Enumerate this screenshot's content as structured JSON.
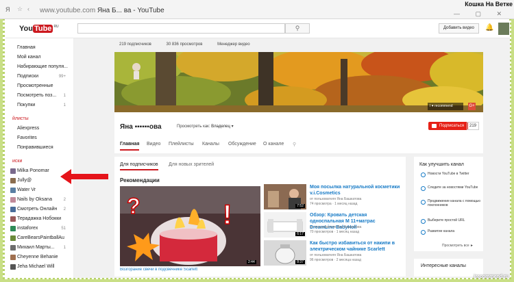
{
  "browser": {
    "tab_icon": "Я",
    "url_host": "www.youtube.com",
    "url_title": "Яна Б... ва - YouTube",
    "watermark": "Кошка На Ветке"
  },
  "header": {
    "logo_you": "You",
    "logo_tube": "Tube",
    "logo_region": "RU",
    "upload_label": "Добавить видео"
  },
  "sidebar": {
    "items": [
      {
        "label": "Главная",
        "count": "",
        "color": ""
      },
      {
        "label": "Мой канал",
        "count": "",
        "color": ""
      },
      {
        "label": "Набирающие популя...",
        "count": "",
        "color": ""
      },
      {
        "label": "Подписки",
        "count": "99+",
        "color": ""
      },
      {
        "label": "Просмотренные",
        "count": "",
        "color": ""
      },
      {
        "label": "Посмотреть поз...",
        "count": "1",
        "color": ""
      },
      {
        "label": "Покупки",
        "count": "1",
        "color": ""
      }
    ],
    "section_playlists": "йлисты",
    "playlists": [
      {
        "label": "Aliexpress"
      },
      {
        "label": "Favorites"
      },
      {
        "label": "Понравившиеся"
      }
    ],
    "section_subscriptions": "иски",
    "subscriptions": [
      {
        "label": "Milka Ponomar",
        "count": "",
        "color": "#7a6a8c"
      },
      {
        "label": "Jully@",
        "count": "",
        "color": "#8a6d4f"
      },
      {
        "label": "Water Vr",
        "count": "",
        "color": "#5a7fa3"
      },
      {
        "label": "Nails by Oksana",
        "count": "2",
        "color": "#c08a9a"
      },
      {
        "label": "Смотреть Онлайн",
        "count": "2",
        "color": "#4a6d9a"
      },
      {
        "label": "Терадажка Нобокки",
        "count": "",
        "color": "#9a5a5a"
      },
      {
        "label": "instaforex",
        "count": "51",
        "color": "#2e8b57"
      },
      {
        "label": "CareBearsPaintballAu",
        "count": "",
        "color": "#6a8a3a"
      },
      {
        "label": "Михаил Марты...",
        "count": "1",
        "color": "#6d6d6d"
      },
      {
        "label": "Cheyenne Behanie",
        "count": "",
        "color": "#a07050"
      },
      {
        "label": "Jeha Michael Will",
        "count": "",
        "color": "#555555"
      }
    ]
  },
  "channel": {
    "stats": [
      "219 подписчиков",
      "30 836 просмотров",
      "Менеджер видео"
    ],
    "name": "Яна ▪▪▪▪▪▪ова",
    "view_as_label": "Просмотреть как:",
    "view_as_value": "Владелец",
    "subscribe_label": "Подписаться",
    "subscribe_count": "219",
    "banner_badge": "I ♥ recommend",
    "banner_gplus": "G+",
    "tabs": [
      "Главная",
      "Видео",
      "Плейлисты",
      "Каналы",
      "Обсуждение",
      "О канале"
    ]
  },
  "feed": {
    "subtabs": [
      "Для подписчиков",
      "Для новых зрителей"
    ],
    "section_title": "Рекомендации",
    "big_video": {
      "duration": "2:44",
      "caption": "Возгорание свечи в подсвечнике Scarlett"
    },
    "videos": [
      {
        "title": "Моя посылка натуральной косметики v.i.Cosmetics",
        "by": "от пользователя Яна Башкатова",
        "meta": "74 просмотра · 1 месяц назад",
        "duration": "7:52"
      },
      {
        "title": "Обзор: Кровать детская односпальная М 11+матрас DreamLine BabyHoll",
        "by": "от пользователя Яна Башкатова",
        "meta": "70 просмотров · 1 месяц назад",
        "duration": "6:17"
      },
      {
        "title": "Как быстро избавиться от накипи в электрическом чайнике Scarlett",
        "by": "от пользователя Яна Башкатова",
        "meta": "96 просмотров · 2 месяца назад",
        "duration": "8:37"
      }
    ]
  },
  "improve": {
    "title": "Как улучшить канал",
    "options": [
      "Новости YouTube в Twitter",
      "Следите за новостями YouTube",
      "Продвижение канала с помощью поклонников",
      "Выберите простой URL",
      "Развитие канала"
    ],
    "view_all": "Просмотреть все ►"
  },
  "interesting": {
    "title": "Интересные каналы"
  },
  "footer_watermark": "irecommend.ru"
}
